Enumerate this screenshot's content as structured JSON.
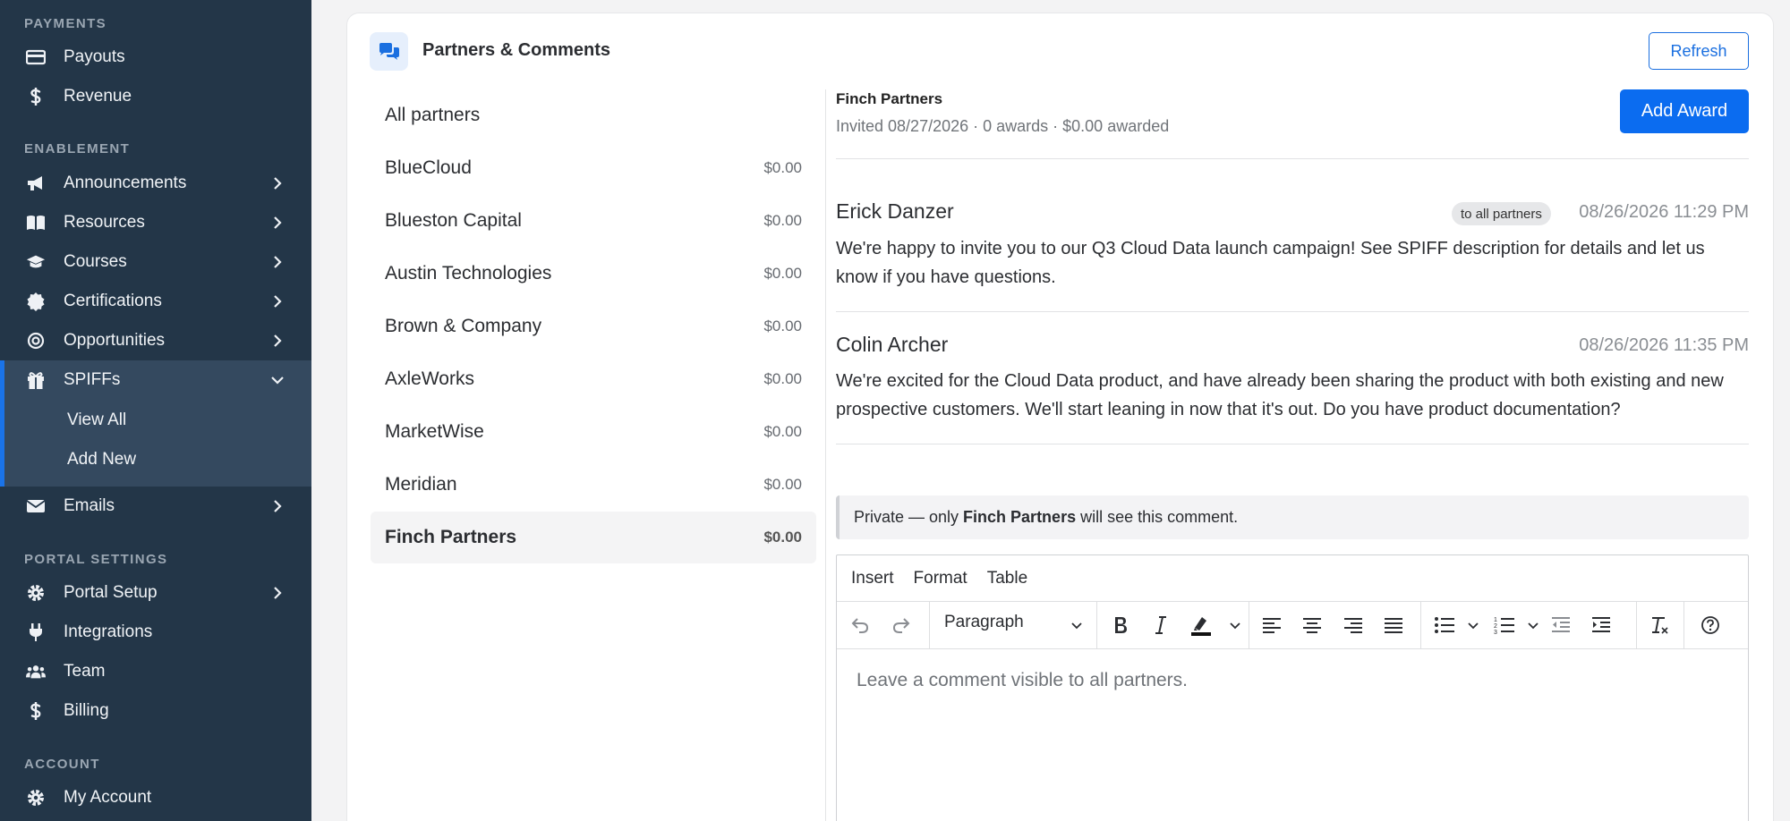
{
  "sidebar": {
    "sections": {
      "payments": "PAYMENTS",
      "enablement": "ENABLEMENT",
      "portal_settings": "PORTAL SETTINGS",
      "account": "ACCOUNT"
    },
    "items": {
      "payouts": "Payouts",
      "revenue": "Revenue",
      "announcements": "Announcements",
      "resources": "Resources",
      "courses": "Courses",
      "certifications": "Certifications",
      "opportunities": "Opportunities",
      "spiffs": "SPIFFs",
      "view_all": "View All",
      "add_new": "Add New",
      "emails": "Emails",
      "portal_setup": "Portal Setup",
      "integrations": "Integrations",
      "team": "Team",
      "billing": "Billing",
      "my_account": "My Account"
    }
  },
  "card": {
    "title": "Partners & Comments",
    "refresh_label": "Refresh"
  },
  "partners": {
    "all_label": "All partners",
    "list": [
      {
        "name": "BlueCloud",
        "amount": "$0.00"
      },
      {
        "name": "Blueston Capital",
        "amount": "$0.00"
      },
      {
        "name": "Austin Technologies",
        "amount": "$0.00"
      },
      {
        "name": "Brown & Company",
        "amount": "$0.00"
      },
      {
        "name": "AxleWorks",
        "amount": "$0.00"
      },
      {
        "name": "MarketWise",
        "amount": "$0.00"
      },
      {
        "name": "Meridian",
        "amount": "$0.00"
      },
      {
        "name": "Finch Partners",
        "amount": "$0.00"
      }
    ]
  },
  "detail": {
    "partner_name": "Finch Partners",
    "meta": "Invited 08/27/2026 · 0 awards · $0.00 awarded",
    "add_award_label": "Add Award"
  },
  "comments": [
    {
      "author": "Erick Danzer",
      "badge": "to all partners",
      "time": "08/26/2026 11:29 PM",
      "body": "We're happy to invite you to our Q3 Cloud Data launch campaign! See SPIFF description for details and let us know if you have questions."
    },
    {
      "author": "Colin Archer",
      "time": "08/26/2026 11:35 PM",
      "body": "We're excited for the Cloud Data product, and have already been sharing the product with both existing and new prospective customers. We'll start leaning in now that it's out. Do you have product documentation?"
    }
  ],
  "private_note": {
    "prefix": "Private — only",
    "partner": "Finch Partners",
    "suffix": "will see this comment."
  },
  "editor": {
    "menu": [
      "Insert",
      "Format",
      "Table"
    ],
    "block_format": "Paragraph",
    "placeholder": "Leave a comment visible to all partners."
  }
}
